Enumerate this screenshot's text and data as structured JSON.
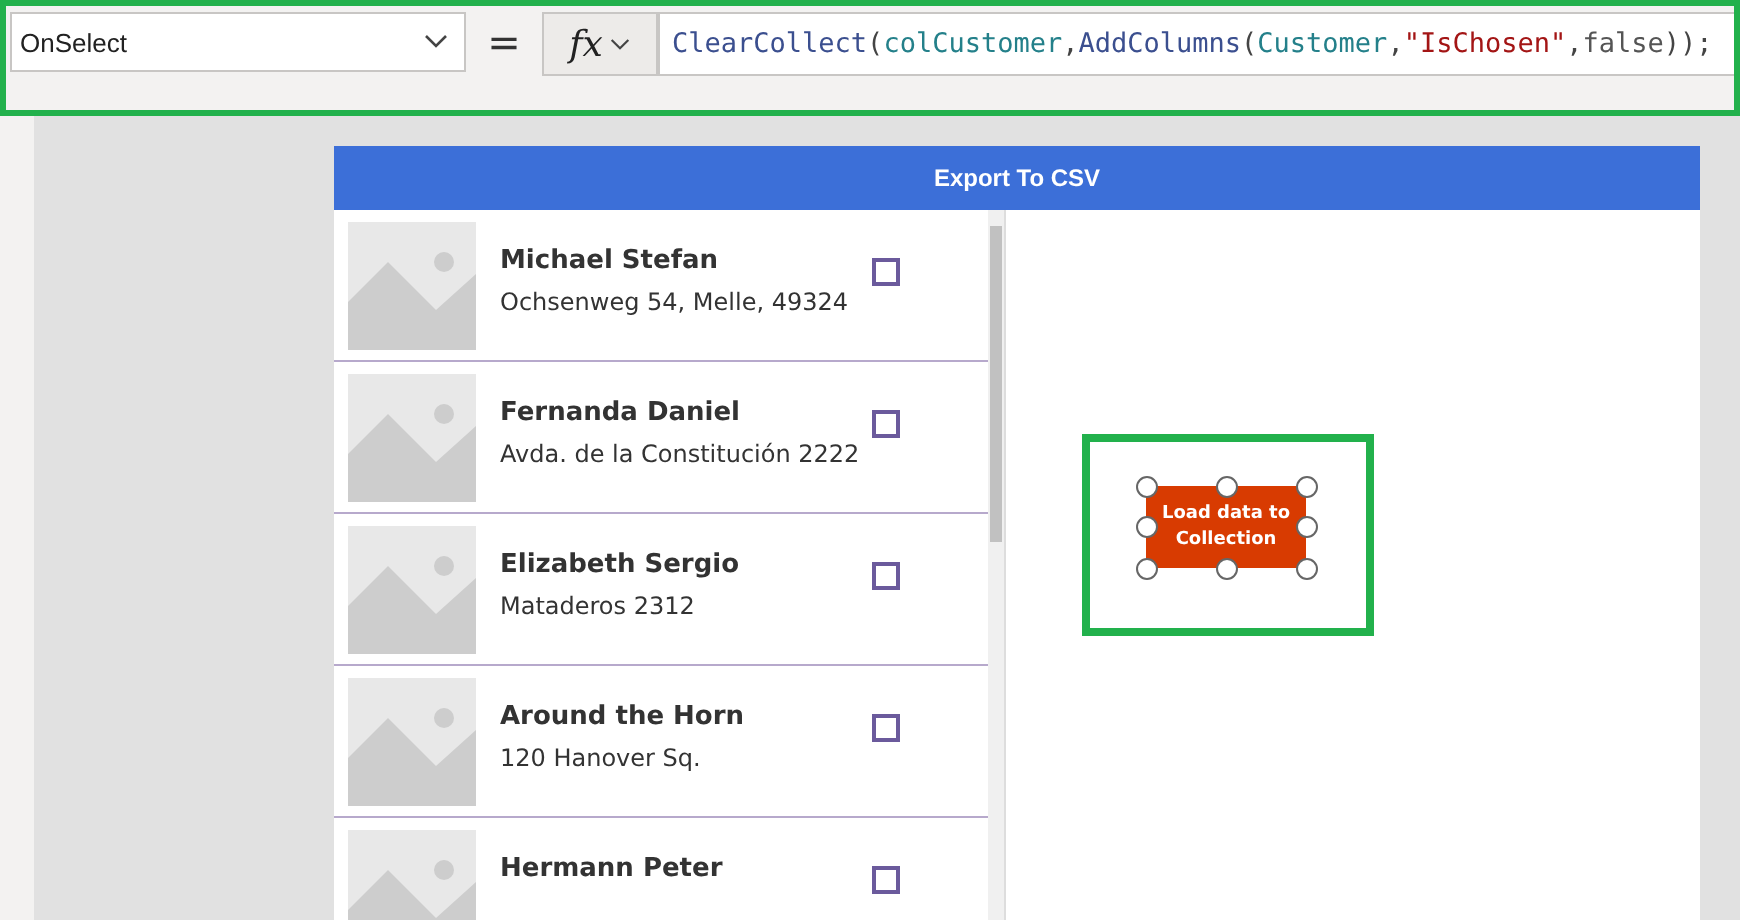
{
  "formula_bar": {
    "property": "OnSelect",
    "equals": "=",
    "fx": "fx",
    "formula": [
      {
        "text": "ClearCollect",
        "kind": "function"
      },
      {
        "text": "(",
        "kind": "punct"
      },
      {
        "text": "colCustomer",
        "kind": "name"
      },
      {
        "text": ",",
        "kind": "punct"
      },
      {
        "text": "AddColumns",
        "kind": "function"
      },
      {
        "text": "(",
        "kind": "punct"
      },
      {
        "text": "Customer",
        "kind": "name"
      },
      {
        "text": ",",
        "kind": "punct"
      },
      {
        "text": "\"IsChosen\"",
        "kind": "string"
      },
      {
        "text": ",",
        "kind": "punct"
      },
      {
        "text": "false",
        "kind": "keyword"
      },
      {
        "text": "));",
        "kind": "punct"
      }
    ]
  },
  "screen": {
    "header": "Export To CSV",
    "gallery": [
      {
        "name": "Michael Stefan",
        "address": "Ochsenweg 54, Melle, 49324",
        "checked": false
      },
      {
        "name": "Fernanda Daniel",
        "address": "Avda. de la Constitución 2222",
        "checked": false
      },
      {
        "name": "Elizabeth Sergio",
        "address": "Mataderos 2312",
        "checked": false
      },
      {
        "name": "Around the Horn",
        "address": "120 Hanover Sq.",
        "checked": false
      },
      {
        "name": "Hermann Peter",
        "checked": false
      }
    ],
    "button": {
      "label": "Load data to Collection",
      "selected": true
    }
  }
}
